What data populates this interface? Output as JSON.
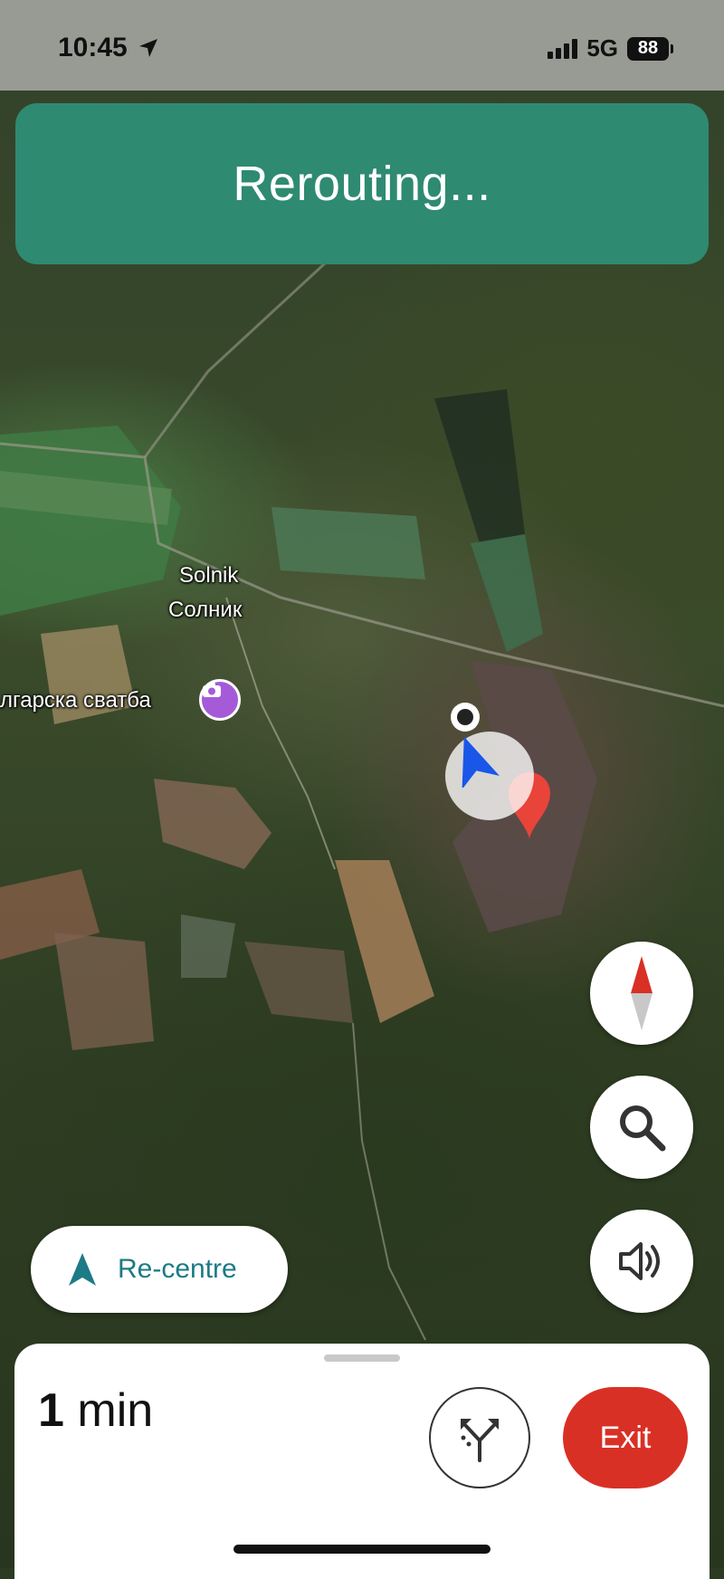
{
  "status_bar": {
    "time": "10:45",
    "network": "5G",
    "battery": "88"
  },
  "banner": {
    "text": "Rerouting..."
  },
  "map": {
    "place_name_latin": "Solnik",
    "place_name_cyrillic": "Солник",
    "poi_label": "лгарска сватба",
    "poi_icon": "camera-icon"
  },
  "controls": {
    "compass_icon": "compass-icon",
    "search_icon": "search-icon",
    "sound_icon": "volume-icon",
    "recentre_label": "Re-centre"
  },
  "bottom_sheet": {
    "eta_value": "1",
    "eta_unit": "min",
    "routes_icon": "alternate-routes-icon",
    "exit_label": "Exit"
  },
  "colors": {
    "banner": "#2f8a72",
    "exit": "#d93025",
    "recentre_text": "#1d7a86",
    "nav_arrow": "#1a56e8",
    "destination_pin": "#e8443a"
  }
}
